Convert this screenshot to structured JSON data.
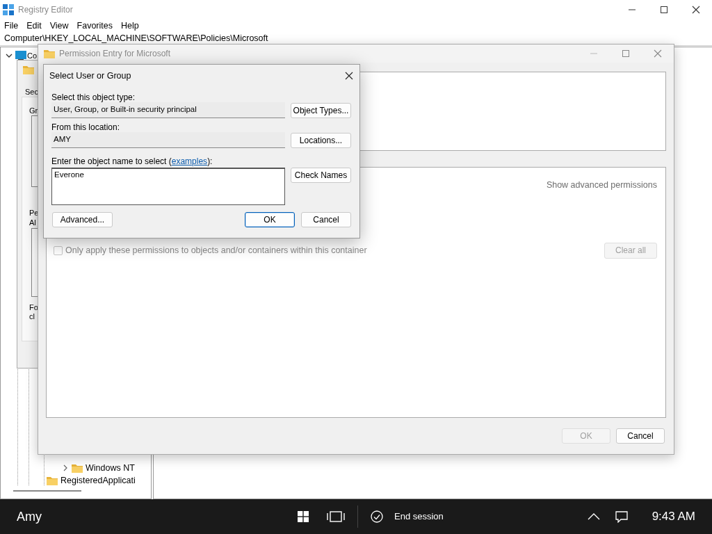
{
  "registry_editor": {
    "title": "Registry Editor",
    "menu": [
      "File",
      "Edit",
      "View",
      "Favorites",
      "Help"
    ],
    "address": "Computer\\HKEY_LOCAL_MACHINE\\SOFTWARE\\Policies\\Microsoft",
    "tree_root": {
      "label": "Co",
      "expanded": true
    },
    "tree_rows": [
      {
        "label": "Windows NT",
        "kind": "collapsed"
      },
      {
        "label": "RegisteredApplicati",
        "kind": "leaf"
      }
    ]
  },
  "properties_dialog": {
    "tab": "Sec",
    "group_label": "Gr",
    "permissions_label": "Pe",
    "permissions_sublabel": "Al",
    "footer_lines": [
      "Fo",
      "cl"
    ]
  },
  "permission_entry": {
    "title": "Permission Entry for Microsoft",
    "show_advanced": "Show advanced permissions",
    "only_apply": {
      "label": "Only apply these permissions to objects and/or containers within this container",
      "checked": false,
      "disabled": true
    },
    "clear_all": {
      "label": "Clear all",
      "disabled": true
    },
    "buttons": [
      {
        "label": "OK",
        "disabled": true
      },
      {
        "label": "Cancel",
        "disabled": false
      }
    ]
  },
  "select_dialog": {
    "title": "Select User or Group",
    "object_type_label": "Select this object type:",
    "object_type": "User, Group, or Built-in security principal",
    "object_types_button": "Object Types...",
    "location_label": "From this location:",
    "location": "AMY",
    "locations_button": "Locations...",
    "name_label": "Enter the object name to select (",
    "examples_link": "examples",
    "name_label_end": "):",
    "name_value": "Everone",
    "check_names_button": "Check Names",
    "advanced_button": "Advanced...",
    "buttons": [
      {
        "label": "OK",
        "default": true
      },
      {
        "label": "Cancel",
        "default": false
      }
    ]
  },
  "taskbar": {
    "user": "Amy",
    "end_session": "End session",
    "time": "9:43 AM"
  }
}
